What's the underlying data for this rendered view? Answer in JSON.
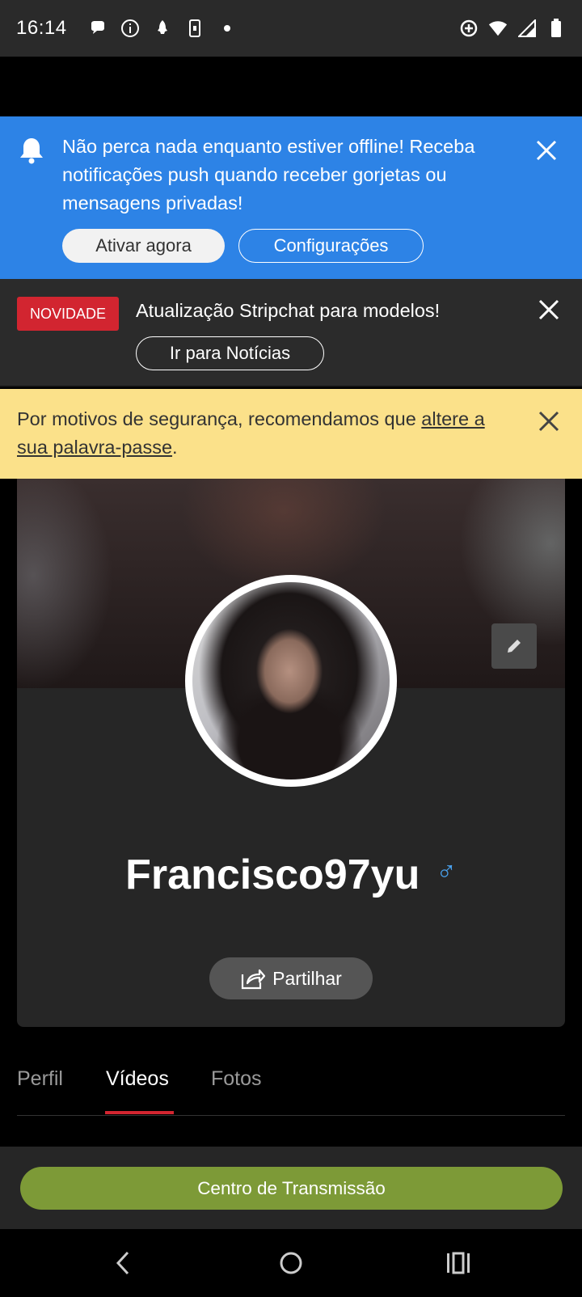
{
  "status_bar": {
    "time": "16:14",
    "left_icons": [
      "chat-bubble-icon",
      "info-icon",
      "rocket-icon",
      "phone-icon",
      "dot-icon"
    ],
    "right_icons": [
      "data-saver-icon",
      "wifi-icon",
      "signal-icon",
      "battery-icon"
    ]
  },
  "push_banner": {
    "message": "Não perca nada enquanto estiver offline! Receba notificações push quando receber gorjetas ou mensagens privadas!",
    "activate_label": "Ativar agora",
    "settings_label": "Configurações"
  },
  "news_banner": {
    "badge": "NOVIDADE",
    "title": "Atualização Stripchat para modelos!",
    "button_label": "Ir para Notícias"
  },
  "security_banner": {
    "text_before": "Por motivos de segurança, recomendamos que ",
    "link_text": "altere a sua palavra-passe",
    "text_after": "."
  },
  "profile": {
    "username": "Francisco97yu",
    "gender_symbol": "♂",
    "share_label": "Partilhar"
  },
  "tabs": [
    {
      "label": "Perfil",
      "active": false
    },
    {
      "label": "Vídeos",
      "active": true
    },
    {
      "label": "Fotos",
      "active": false
    }
  ],
  "bottom_bar": {
    "broadcast_label": "Centro de Transmissão"
  },
  "colors": {
    "push_bg": "#2d83e6",
    "badge_red": "#d22530",
    "security_bg": "#fbe18a",
    "broadcast_green": "#7d9a37",
    "gender_blue": "#4aa3f0"
  }
}
